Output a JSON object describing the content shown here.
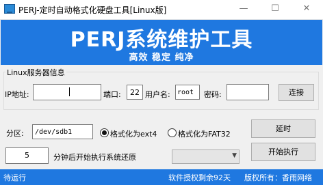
{
  "window": {
    "title": "PERJ-定时自动格式化硬盘工具[Linux版]",
    "min_glyph": "—",
    "max_glyph": "☐",
    "close_glyph": "✕"
  },
  "banner": {
    "title": "PERJ系统维护工具",
    "subtitle": "高效  稳定  纯净",
    "color": "#1f78e0"
  },
  "server_group": {
    "label": "Linux服务器信息",
    "ip_label": "IP地址:",
    "ip_value": "",
    "port_label": "端口:",
    "port_value": "22",
    "user_label": "用户名:",
    "user_value": "root",
    "password_label": "密码:",
    "password_value": "",
    "connect_button": "连接"
  },
  "format": {
    "partition_label": "分区:",
    "partition_value": "/dev/sdb1",
    "option_ext4": "格式化为ext4",
    "option_fat32": "格式化为FAT32",
    "selected": "ext4",
    "delay_button": "延时",
    "minutes_value": "5",
    "minutes_label": "分钟后开始执行系统还原",
    "execute_button": "开始执行",
    "combo_value": ""
  },
  "status": {
    "state": "待运行",
    "license": "软件授权剩余92天",
    "copyright": "版权所有：香雨网络"
  }
}
